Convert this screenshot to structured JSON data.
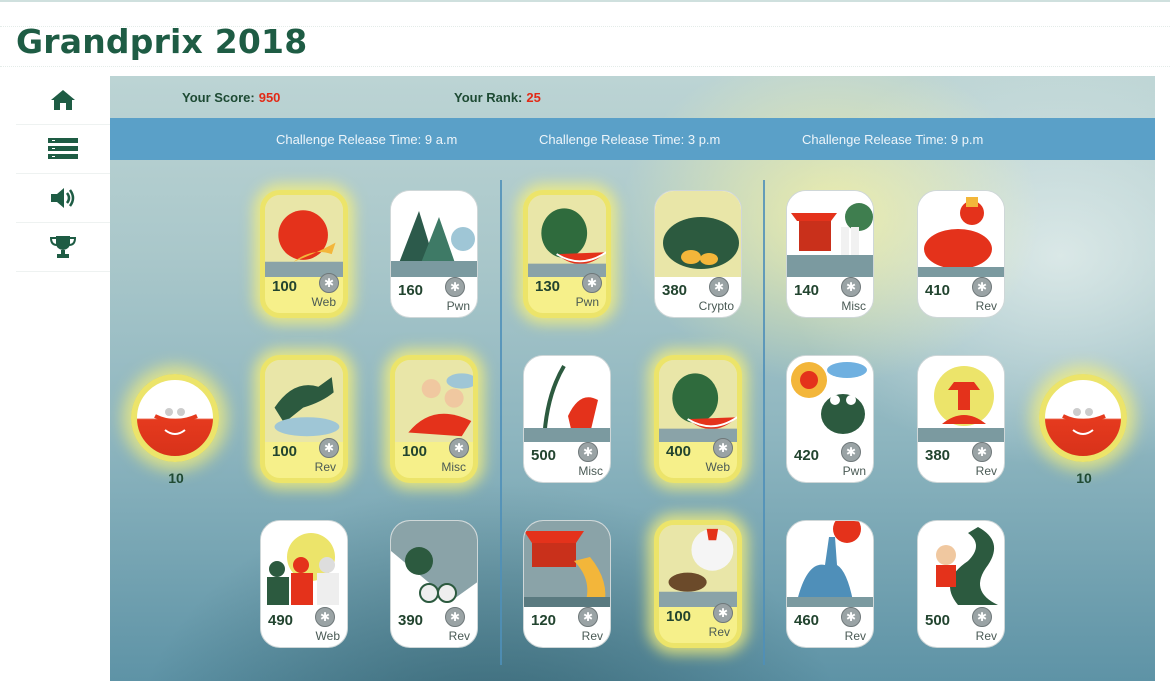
{
  "page": {
    "title": "Grandprix 2018"
  },
  "sidebar": {
    "items": [
      {
        "icon": "home-icon"
      },
      {
        "icon": "list-icon"
      },
      {
        "icon": "speaker-icon"
      },
      {
        "icon": "trophy-icon"
      }
    ]
  },
  "scoreboard": {
    "score_label": "Your Score:",
    "score_value": "950",
    "rank_label": "Your Rank:",
    "rank_value": "25"
  },
  "release_times": [
    "Challenge Release Time: 9 a.m",
    "Challenge Release Time: 3 p.m",
    "Challenge Release Time: 9 p.m"
  ],
  "bonus": {
    "left": {
      "points": "10"
    },
    "right": {
      "points": "10"
    }
  },
  "challenges": [
    {
      "points": "100",
      "category": "Web",
      "solved": true
    },
    {
      "points": "160",
      "category": "Pwn",
      "solved": false
    },
    {
      "points": "130",
      "category": "Pwn",
      "solved": true
    },
    {
      "points": "380",
      "category": "Crypto",
      "solved": false
    },
    {
      "points": "140",
      "category": "Misc",
      "solved": false
    },
    {
      "points": "410",
      "category": "Rev",
      "solved": false
    },
    {
      "points": "100",
      "category": "Rev",
      "solved": true
    },
    {
      "points": "100",
      "category": "Misc",
      "solved": true
    },
    {
      "points": "500",
      "category": "Misc",
      "solved": false
    },
    {
      "points": "400",
      "category": "Web",
      "solved": true
    },
    {
      "points": "420",
      "category": "Pwn",
      "solved": false
    },
    {
      "points": "380",
      "category": "Rev",
      "solved": false
    },
    {
      "points": "490",
      "category": "Web",
      "solved": false
    },
    {
      "points": "390",
      "category": "Rev",
      "solved": false
    },
    {
      "points": "120",
      "category": "Rev",
      "solved": false
    },
    {
      "points": "100",
      "category": "Rev",
      "solved": true
    },
    {
      "points": "460",
      "category": "Rev",
      "solved": false
    },
    {
      "points": "500",
      "category": "Rev",
      "solved": false
    }
  ],
  "colors": {
    "title": "#1e5c44",
    "score_value": "#e22a16",
    "release_bar": "#5aa0c8",
    "solved_glow": "#ece46a"
  }
}
